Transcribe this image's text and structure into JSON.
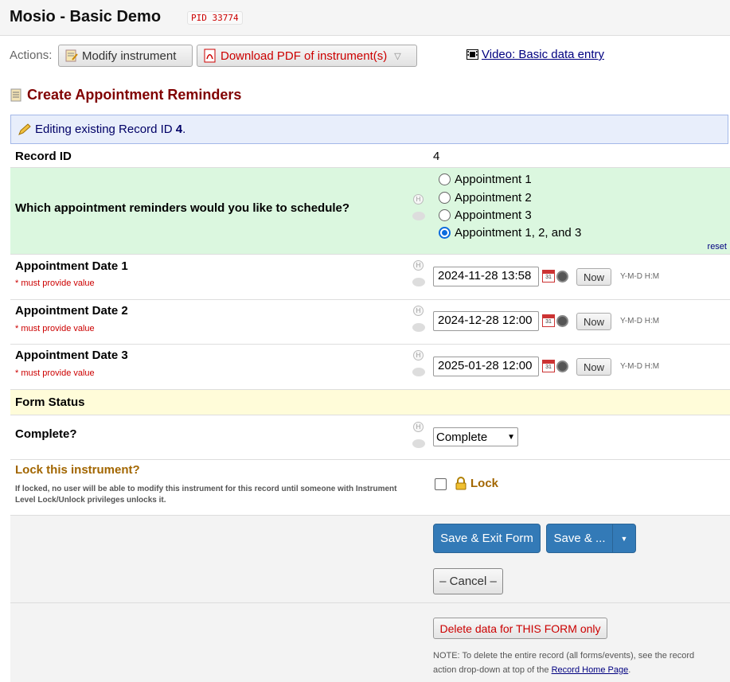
{
  "header": {
    "title": "Mosio - Basic Demo",
    "pid": "PID 33774"
  },
  "actions": {
    "label": "Actions:",
    "modify": "Modify instrument",
    "pdf": "Download PDF of instrument(s)",
    "video": "Video: Basic data entry"
  },
  "form": {
    "title": "Create Appointment Reminders",
    "editing_prefix": "Editing existing Record ID ",
    "editing_id": "4",
    "editing_suffix": "."
  },
  "fields": {
    "record_id": {
      "label": "Record ID",
      "value": "4"
    },
    "reminders": {
      "label": "Which appointment reminders would you like to schedule?",
      "options": [
        "Appointment 1",
        "Appointment 2",
        "Appointment 3",
        "Appointment 1, 2, and 3"
      ],
      "selected": "Appointment 1, 2, and 3",
      "reset": "reset"
    },
    "dates": [
      {
        "label": "Appointment Date 1",
        "required": "* must provide value",
        "value": "2024-11-28 13:58"
      },
      {
        "label": "Appointment Date 2",
        "required": "* must provide value",
        "value": "2024-12-28 12:00"
      },
      {
        "label": "Appointment Date 3",
        "required": "* must provide value",
        "value": "2025-01-28 12:00"
      }
    ],
    "now_label": "Now",
    "date_format": "Y-M-D H:M",
    "form_status": {
      "label": "Form Status"
    },
    "complete": {
      "label": "Complete?",
      "value": "Complete"
    },
    "lock": {
      "label": "Lock this instrument?",
      "description": "If locked, no user will be able to modify this instrument for this record until someone with Instrument Level Lock/Unlock privileges unlocks it.",
      "checkbox_label": "Lock"
    }
  },
  "buttons": {
    "save_exit": "Save & Exit Form",
    "save_more": "Save & ...",
    "cancel": "– Cancel –",
    "delete": "Delete data for THIS FORM only"
  },
  "note": {
    "text": "NOTE: To delete the entire record (all forms/events), see the record action drop-down at top of the ",
    "link": "Record Home Page",
    "end": "."
  },
  "colors": {
    "title_red": "#800000",
    "green_row": "#dbf7df",
    "yellow_row": "#fffcd9",
    "save_blue": "#337ab7"
  },
  "icons": [
    "pencil-icon",
    "form-icon",
    "pdf-icon",
    "film-icon",
    "calendar-icon",
    "clock-icon",
    "lock-icon",
    "history-icon",
    "comment-icon"
  ]
}
